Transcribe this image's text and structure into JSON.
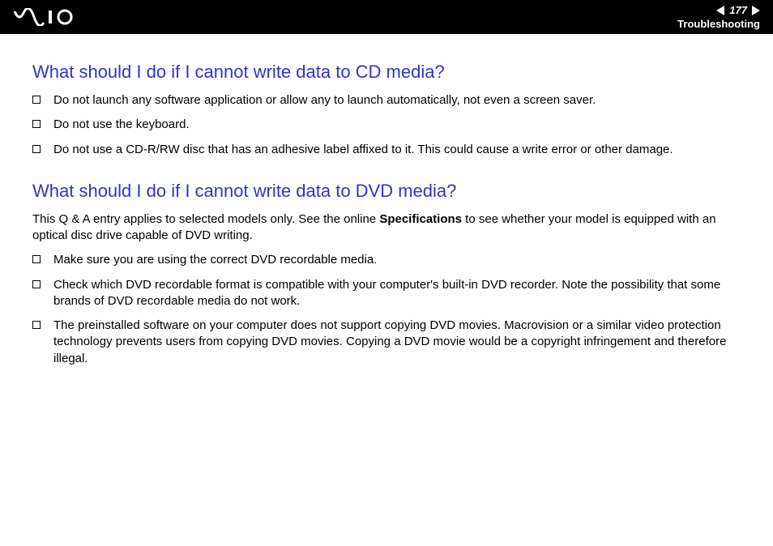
{
  "header": {
    "page_number": "177",
    "section": "Troubleshooting"
  },
  "section1": {
    "heading": "What should I do if I cannot write data to CD media?",
    "bullets": [
      "Do not launch any software application or allow any to launch automatically, not even a screen saver.",
      "Do not use the keyboard.",
      "Do not use a CD-R/RW disc that has an adhesive label affixed to it. This could cause a write error or other damage."
    ]
  },
  "section2": {
    "heading": "What should I do if I cannot write data to DVD media?",
    "intro_before": "This Q & A entry applies to selected models only. See the online ",
    "intro_bold": "Specifications",
    "intro_after": " to see whether your model is equipped with an optical disc drive capable of DVD writing.",
    "bullets": [
      "Make sure you are using the correct DVD recordable media.",
      "Check which DVD recordable format is compatible with your computer's built-in DVD recorder. Note the possibility that some brands of DVD recordable media do not work.",
      "The preinstalled software on your computer does not support copying DVD movies. Macrovision or a similar video protection technology prevents users from copying DVD movies. Copying a DVD movie would be a copyright infringement and therefore illegal."
    ]
  }
}
